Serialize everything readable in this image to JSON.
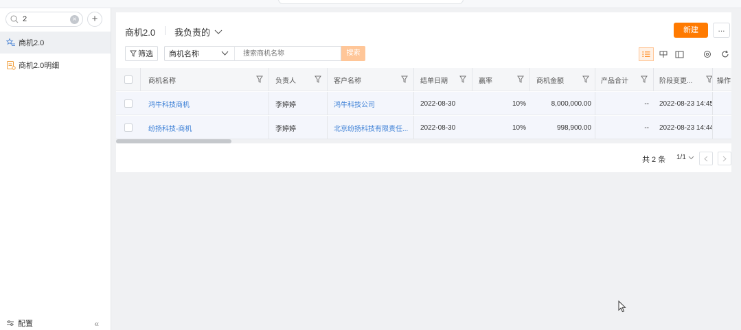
{
  "sidebar": {
    "search_value": "2",
    "items": [
      {
        "label": "商机2.0"
      },
      {
        "label": "商机2.0明细"
      }
    ],
    "config_label": "配置",
    "collapse_glyph": "«"
  },
  "header": {
    "title": "商机2.0",
    "view_label": "我负责的",
    "new_button": "新建",
    "more_button": "..."
  },
  "filter": {
    "filter_label": "筛选",
    "field_label": "商机名称",
    "search_placeholder": "搜索商机名称",
    "search_button": "搜索"
  },
  "table": {
    "columns": [
      "商机名称",
      "负责人",
      "客户名称",
      "结单日期",
      "赢率",
      "商机金额",
      "产品合计",
      "阶段变更...",
      "操作"
    ],
    "rows": [
      {
        "name": "鸿牛科技商机",
        "owner": "李婷婷",
        "customer": "鸿牛科技公司",
        "close_date": "2022-08-30",
        "win_rate": "10%",
        "amount": "8,000,000.00",
        "product_total": "--",
        "stage_change": "2022-08-23 14:45"
      },
      {
        "name": "纷扬科技-商机",
        "owner": "李婷婷",
        "customer": "北京纷扬科技有限责任...",
        "close_date": "2022-08-30",
        "win_rate": "10%",
        "amount": "998,900.00",
        "product_total": "--",
        "stage_change": "2022-08-23 14:44"
      }
    ]
  },
  "pagination": {
    "total": "共 2 条",
    "page": "1/1"
  },
  "colors": {
    "accent": "#ff7a00",
    "link": "#3b7fd6"
  }
}
